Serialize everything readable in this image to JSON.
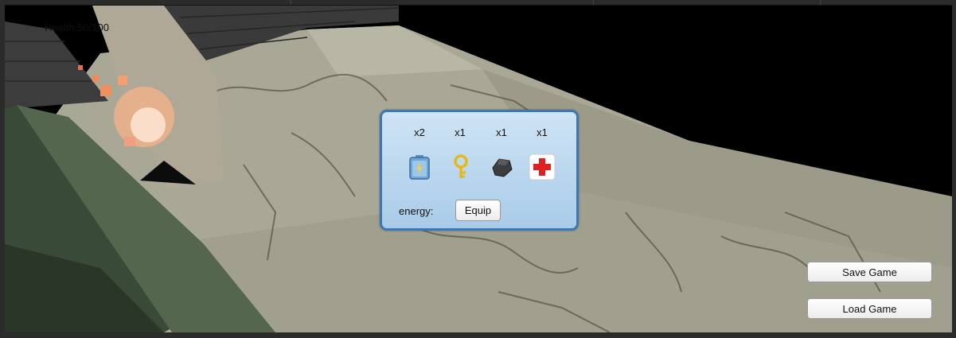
{
  "hud": {
    "health_label": "Health:50/100"
  },
  "inventory": {
    "items": [
      {
        "icon": "battery-icon",
        "count": "x2"
      },
      {
        "icon": "key-icon",
        "count": "x1"
      },
      {
        "icon": "stone-icon",
        "count": "x1"
      },
      {
        "icon": "medkit-icon",
        "count": "x1"
      }
    ],
    "energy_label": "energy:",
    "equip_label": "Equip"
  },
  "menu": {
    "save_label": "Save Game",
    "load_label": "Load Game"
  },
  "colors": {
    "panel_border": "#3d78b3",
    "panel_fill": "#bcd8ef",
    "medkit_red": "#e02020",
    "key_gold": "#e3b91c"
  }
}
